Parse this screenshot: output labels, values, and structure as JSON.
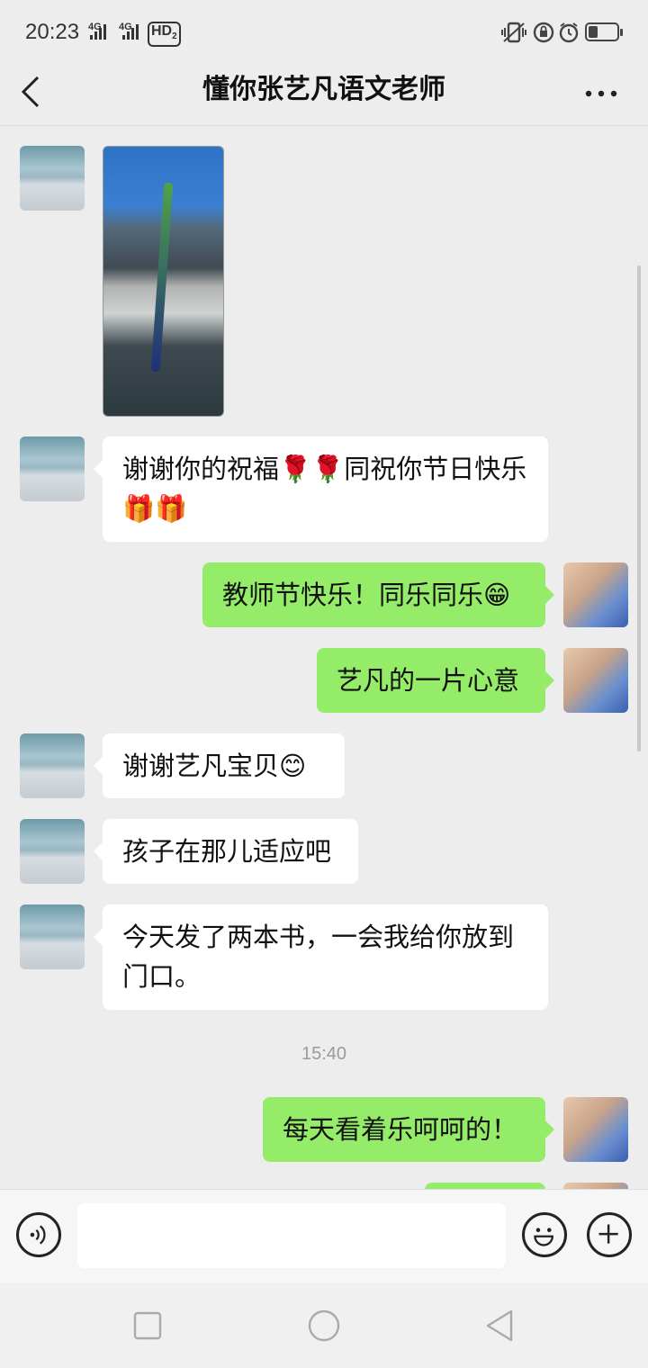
{
  "status_bar": {
    "time": "20:23",
    "net1": "4G",
    "net2": "4G",
    "hd": "HD",
    "hd_sub": "2"
  },
  "nav": {
    "title": "懂你张艺凡语文老师",
    "back_icon": "chevron-left-icon",
    "more_icon": "more-dots-icon"
  },
  "messages": [
    {
      "sender": "teacher",
      "type": "image"
    },
    {
      "sender": "teacher",
      "line1": "谢谢你的祝福🌹🌹同祝你节日快乐",
      "line2": "🎁🎁"
    },
    {
      "sender": "me",
      "text": "教师节快乐！同乐同乐😁"
    },
    {
      "sender": "me",
      "text": "艺凡的一片心意"
    },
    {
      "sender": "teacher",
      "text": "谢谢艺凡宝贝😊"
    },
    {
      "sender": "teacher",
      "text": "孩子在那儿适应吧"
    },
    {
      "sender": "teacher",
      "line1": "今天发了两本书，一会我给你放到",
      "line2": "门口。"
    },
    {
      "type": "time",
      "text": "15:40"
    },
    {
      "sender": "me",
      "text": "每天看着乐呵呵的！"
    }
  ],
  "input_bar": {
    "voice_icon": "voice-icon",
    "input_value": "",
    "emoji_icon": "emoji-icon",
    "plus_icon": "plus-icon"
  },
  "colors": {
    "background": "#ededed",
    "outgoing_bubble": "#95ec69",
    "incoming_bubble": "#ffffff"
  }
}
